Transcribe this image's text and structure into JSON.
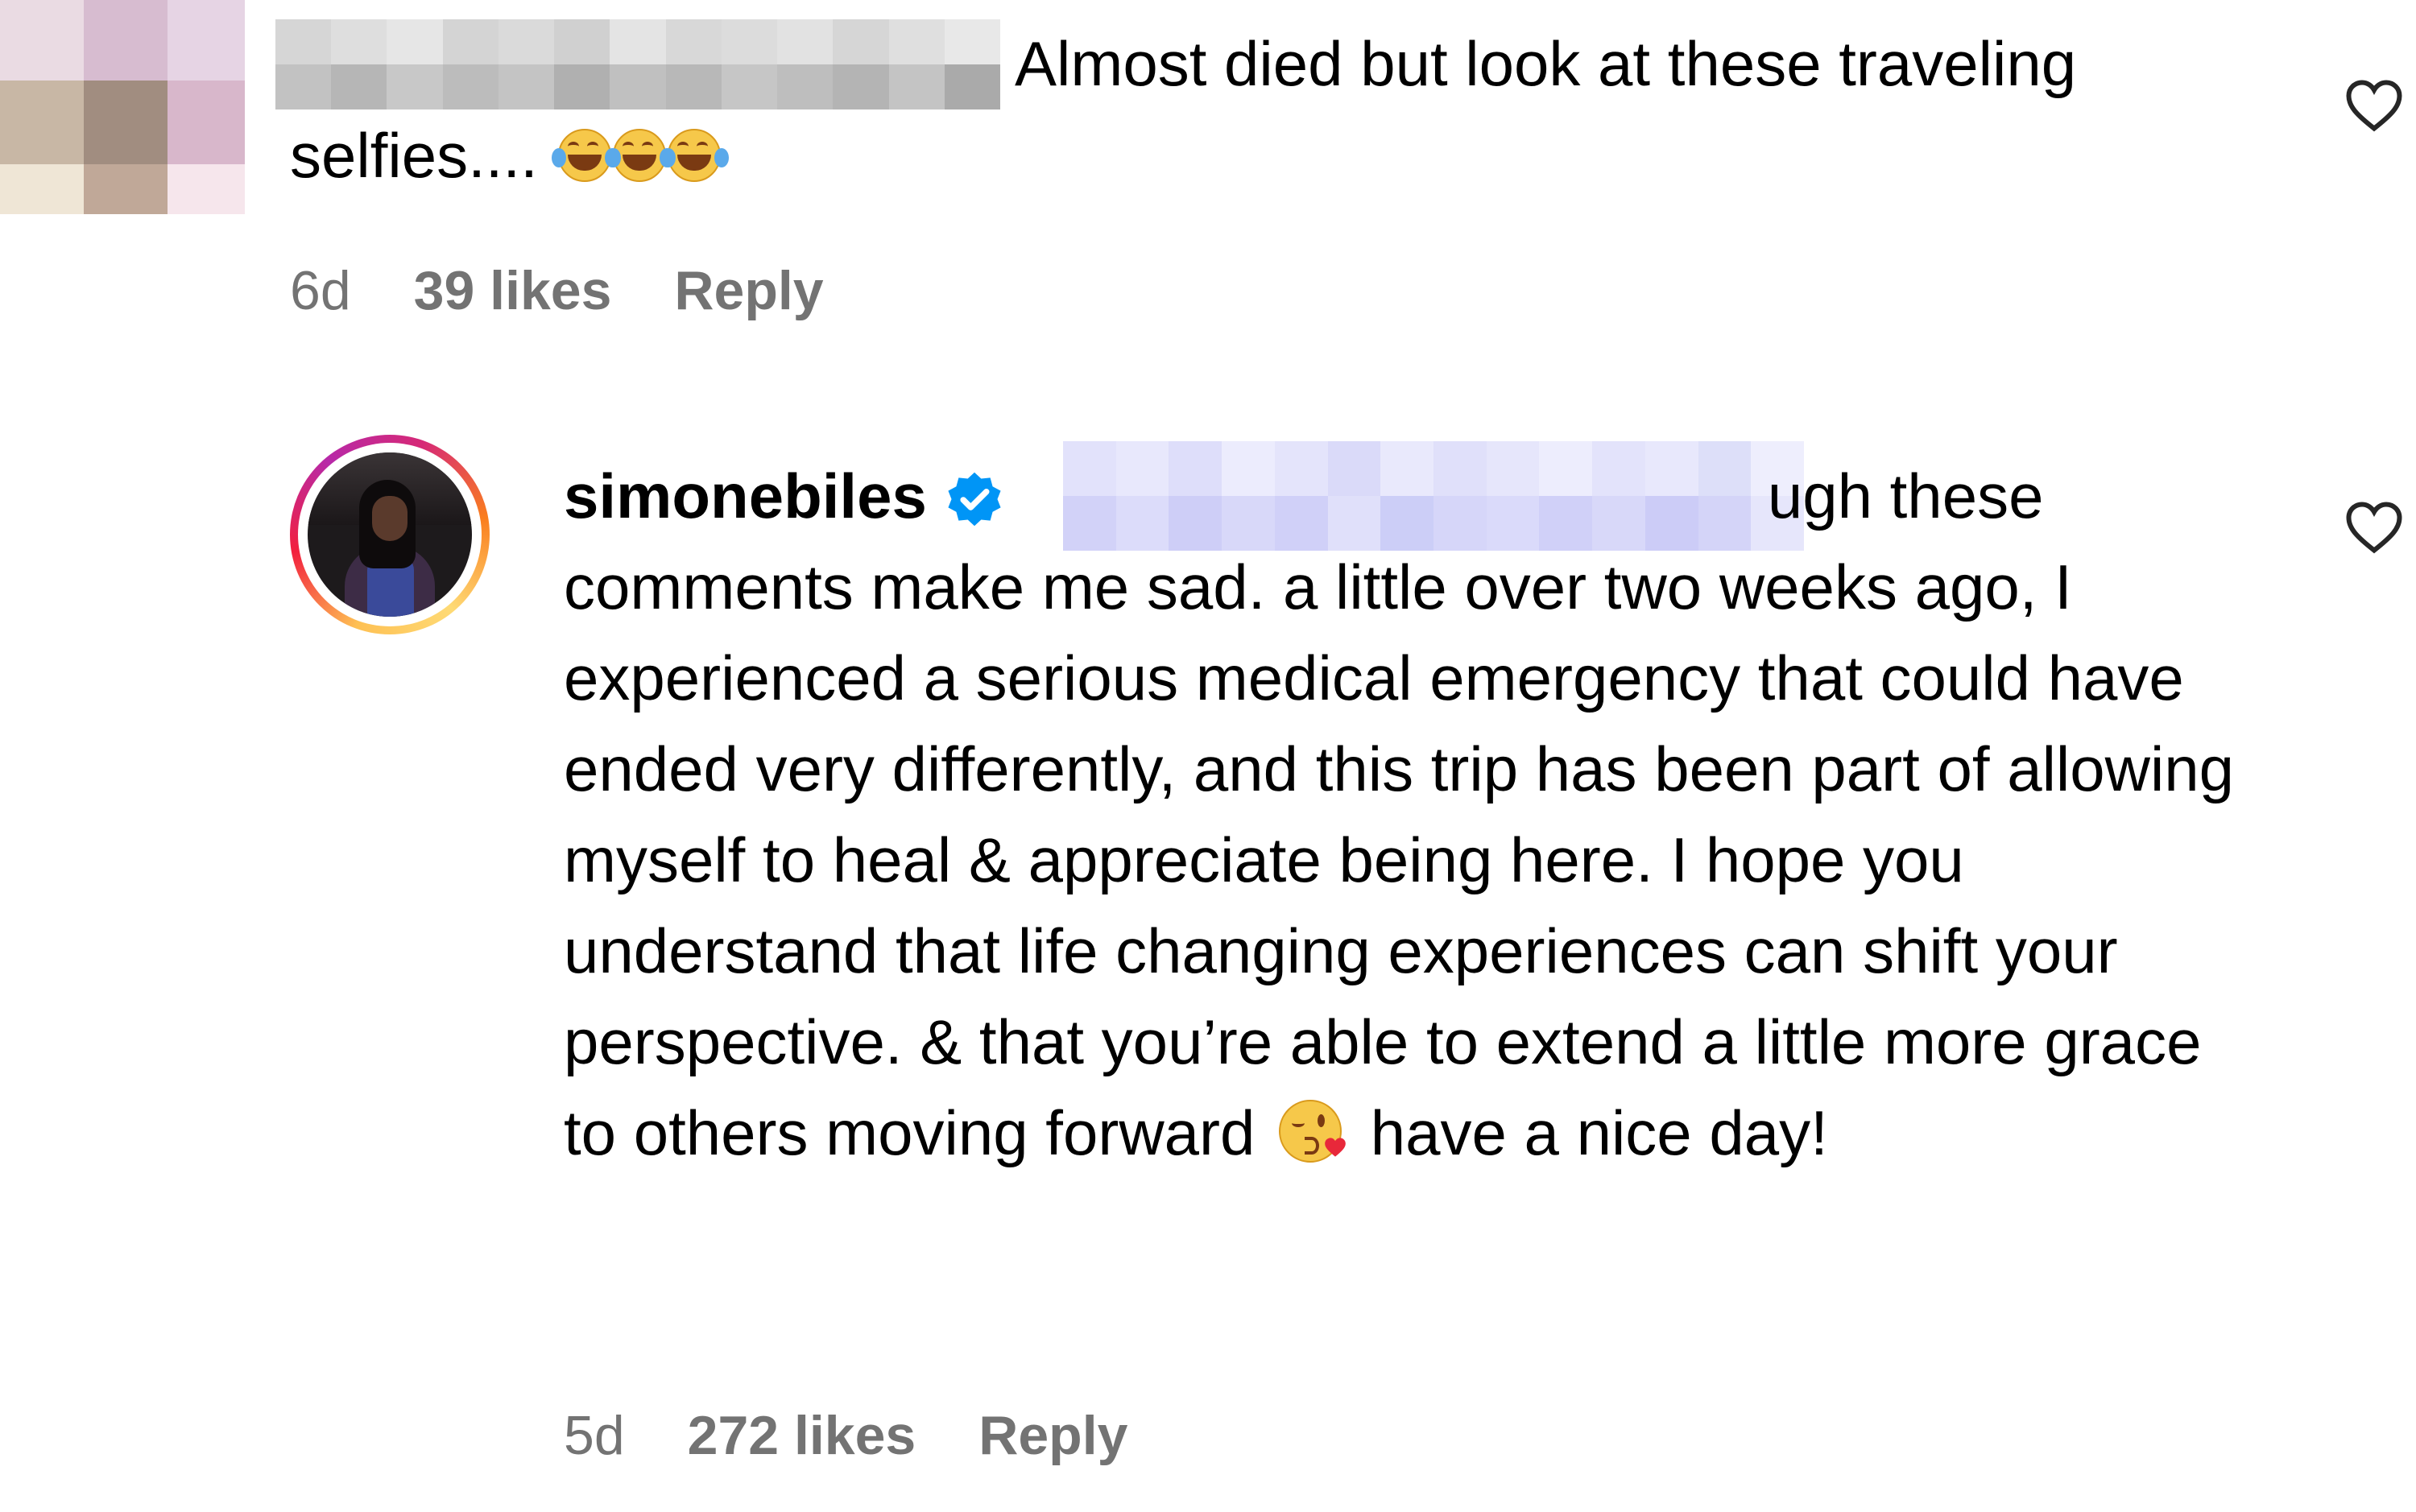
{
  "comment_1": {
    "text_line_1": "Almost died but look at these traveling",
    "text_line_2": "selfies....",
    "time": "6d",
    "likes": "39 likes",
    "reply_label": "Reply",
    "emoji_icons": [
      "face-with-tears-of-joy-icon",
      "face-with-tears-of-joy-icon",
      "face-with-tears-of-joy-icon"
    ]
  },
  "comment_2": {
    "username": "simonebiles",
    "verified_icon": "verified-badge-icon",
    "text_start": "ugh these",
    "text_body": "comments make me sad. a little over two weeks ago, I experienced a serious medical emergency that could have ended very differently, and this trip has been part of allowing myself to heal & appreciate being here. I hope you understand that life changing experiences can shift your perspective. & that you’re able to extend a little more grace to others moving forward",
    "emoji_icon": "face-blowing-a-kiss-icon",
    "text_end": "have a nice day!",
    "time": "5d",
    "likes": "272 likes",
    "reply_label": "Reply"
  },
  "icons": {
    "like": "heart-outline-icon"
  },
  "colors": {
    "meta_text": "#737373",
    "verified_blue": "#0095f6",
    "redaction_gray": "#c8c8c8",
    "redaction_lavender": "#e6e6fb"
  }
}
